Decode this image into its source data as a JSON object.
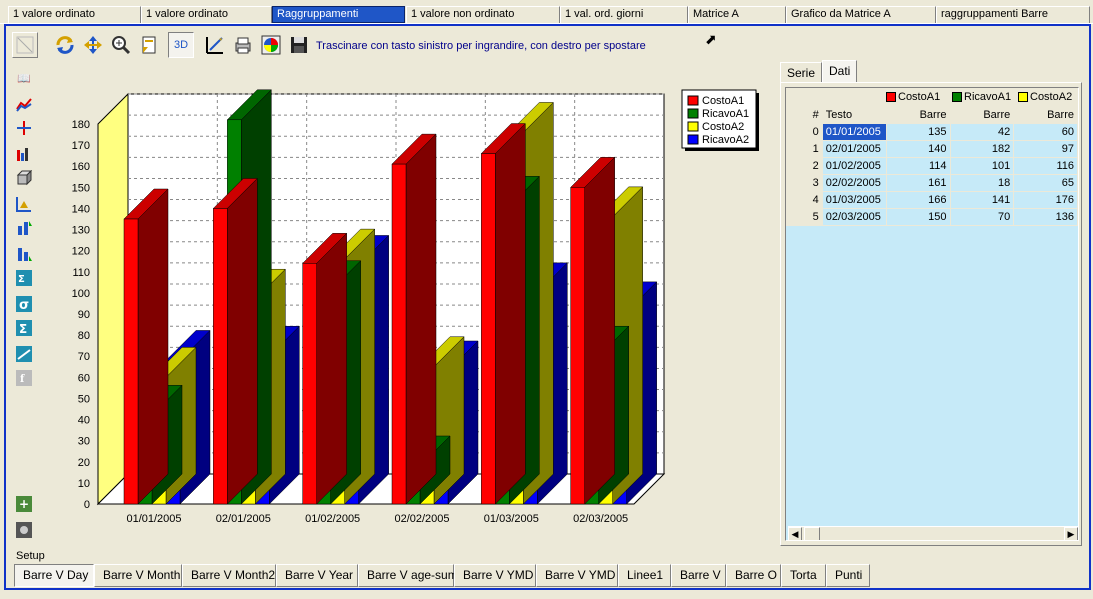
{
  "top_tabs": [
    {
      "label": "1 valore ordinato",
      "active": false
    },
    {
      "label": "1 valore ordinato",
      "active": false
    },
    {
      "label": "Raggruppamenti",
      "active": true
    },
    {
      "label": "1 valore non ordinato",
      "active": false
    },
    {
      "label": "1 val. ord. giorni",
      "active": false
    },
    {
      "label": "Matrice A",
      "active": false
    },
    {
      "label": "Grafico da Matrice A",
      "active": false
    },
    {
      "label": "raggruppamenti Barre",
      "active": false
    }
  ],
  "toolbar": {
    "hint": "Trascinare con tasto sinistro per ingrandire, con destro per spostare",
    "label_3d": "3D"
  },
  "right_panel": {
    "tabs": [
      {
        "label": "Serie",
        "active": false
      },
      {
        "label": "Dati",
        "active": true
      }
    ],
    "legend": [
      {
        "name": "CostoA1",
        "color": "#ff0000"
      },
      {
        "name": "RicavoA1",
        "color": "#008000"
      },
      {
        "name": "CostoA2",
        "color": "#ffff00"
      }
    ],
    "header": {
      "index": "#",
      "text": "Testo",
      "cols": [
        "Barre",
        "Barre",
        "Barre"
      ]
    },
    "rows": [
      {
        "i": "0",
        "date": "01/01/2005",
        "v": [
          "135",
          "42",
          "60"
        ]
      },
      {
        "i": "1",
        "date": "02/01/2005",
        "v": [
          "140",
          "182",
          "97"
        ]
      },
      {
        "i": "2",
        "date": "01/02/2005",
        "v": [
          "114",
          "101",
          "116"
        ]
      },
      {
        "i": "3",
        "date": "02/02/2005",
        "v": [
          "161",
          "18",
          "65"
        ]
      },
      {
        "i": "4",
        "date": "01/03/2005",
        "v": [
          "166",
          "141",
          "176"
        ]
      },
      {
        "i": "5",
        "date": "02/03/2005",
        "v": [
          "150",
          "70",
          "136"
        ]
      }
    ]
  },
  "setup": {
    "label": "Setup",
    "buttons": [
      {
        "label": "Barre V Day",
        "active": true
      },
      {
        "label": "Barre V Month",
        "active": false
      },
      {
        "label": "Barre V Month2",
        "active": false
      },
      {
        "label": "Barre V Year",
        "active": false
      },
      {
        "label": "Barre V age-sum",
        "active": false
      },
      {
        "label": "Barre V YMD",
        "active": false
      },
      {
        "label": "Barre V YMD",
        "active": false
      },
      {
        "label": "Linee1",
        "active": false
      },
      {
        "label": "Barre V",
        "active": false
      },
      {
        "label": "Barre O",
        "active": false
      },
      {
        "label": "Torta",
        "active": false
      },
      {
        "label": "Punti",
        "active": false
      }
    ]
  },
  "icons": {
    "toolbar": [
      "zoom-rect-icon",
      "refresh-icon",
      "pan-icon",
      "zoom-icon",
      "page-icon",
      "3d-icon",
      "edit-chart-icon",
      "print-icon",
      "palette-icon",
      "save-icon"
    ],
    "left": [
      "book-icon",
      "chart-icon",
      "crosshair-icon",
      "bar-icon",
      "cube-icon",
      "axis-icon",
      "sort-asc-icon",
      "sort-desc-icon",
      "sum-n-icon",
      "sigma-small-icon",
      "sigma-icon",
      "trend-icon",
      "formula-icon",
      "add-icon",
      "gear-icon"
    ]
  },
  "chart_data": {
    "type": "bar",
    "categories": [
      "01/01/2005",
      "02/01/2005",
      "01/02/2005",
      "02/02/2005",
      "01/03/2005",
      "02/03/2005"
    ],
    "series": [
      {
        "name": "CostoA1",
        "color": "#ff0000",
        "values": [
          135,
          140,
          114,
          161,
          166,
          150
        ]
      },
      {
        "name": "RicavoA1",
        "color": "#008000",
        "values": [
          42,
          182,
          101,
          18,
          141,
          70
        ]
      },
      {
        "name": "CostoA2",
        "color": "#ffff00",
        "values": [
          60,
          97,
          116,
          65,
          176,
          136
        ]
      },
      {
        "name": "RicavoA2",
        "color": "#0000ff",
        "values": [
          68,
          70,
          113,
          63,
          100,
          91
        ]
      }
    ],
    "ylim": [
      0,
      180
    ],
    "yticks": [
      0,
      10,
      20,
      30,
      40,
      50,
      60,
      70,
      80,
      90,
      100,
      110,
      120,
      130,
      140,
      150,
      160,
      170,
      180
    ],
    "grid": true,
    "legend": "top-right",
    "three_d": true,
    "title": "",
    "xlabel": "",
    "ylabel": ""
  }
}
